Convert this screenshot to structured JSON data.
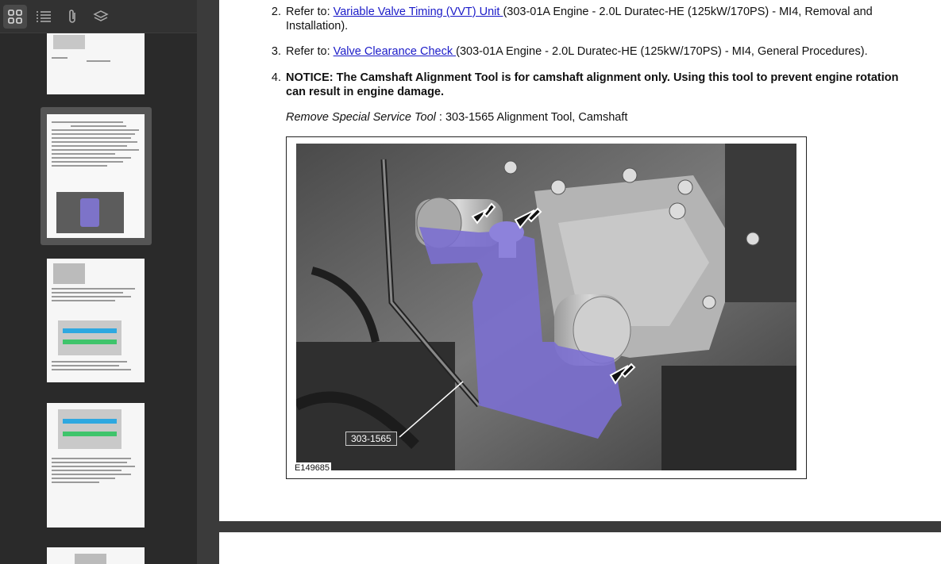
{
  "sidebar": {
    "toolbar": [
      {
        "name": "thumbnails-icon",
        "active": true
      },
      {
        "name": "outline-icon",
        "active": false
      },
      {
        "name": "attachments-icon",
        "active": false
      },
      {
        "name": "layers-icon",
        "active": false
      }
    ]
  },
  "document": {
    "steps": [
      {
        "num": "2.",
        "prefix": "Refer to: ",
        "link": "Variable Valve Timing (VVT) Unit ",
        "suffix_line1": "(303-01A Engine - 2.0L Duratec-HE (125kW/170PS) - MI4, Removal and",
        "suffix_line2": "Installation)."
      },
      {
        "num": "3.",
        "prefix": "Refer to: ",
        "link": "Valve Clearance Check ",
        "suffix_line1": "(303-01A Engine - 2.0L Duratec-HE (125kW/170PS) - MI4, General Procedures)."
      },
      {
        "num": "4.",
        "notice_line1": "NOTICE: The Camshaft Alignment Tool is for camshaft alignment only. Using this tool to prevent engine rotation",
        "notice_line2": "can result in engine damage.",
        "tool_label": "Remove Special Service Tool",
        "tool_text": " : 303-1565 Alignment Tool, Camshaft"
      }
    ],
    "figure": {
      "code": "E149685",
      "callout": "303-1565"
    }
  }
}
